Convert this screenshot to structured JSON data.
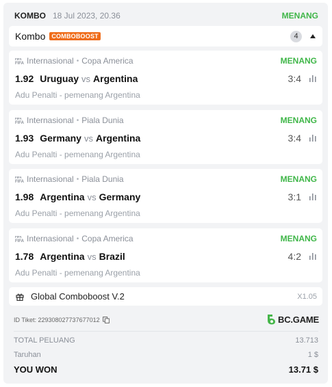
{
  "header": {
    "title": "KOMBO",
    "date": "18 Jul 2023, 20.36",
    "status": "MENANG"
  },
  "kombo": {
    "label": "Kombo",
    "badge": "COMBOBOOST",
    "count": "4"
  },
  "matches": [
    {
      "category": "Internasional",
      "league": "Copa America",
      "status": "MENANG",
      "odds": "1.92",
      "team1": "Uruguay",
      "vs": "vs",
      "team2": "Argentina",
      "score": "3:4",
      "market": "Adu Penalti - pemenang Argentina"
    },
    {
      "category": "Internasional",
      "league": "Piala Dunia",
      "status": "MENANG",
      "odds": "1.93",
      "team1": "Germany",
      "vs": "vs",
      "team2": "Argentina",
      "score": "3:4",
      "market": "Adu Penalti - pemenang Argentina"
    },
    {
      "category": "Internasional",
      "league": "Piala Dunia",
      "status": "MENANG",
      "odds": "1.98",
      "team1": "Argentina",
      "vs": "vs",
      "team2": "Germany",
      "score": "3:1",
      "market": "Adu Penalti - pemenang Argentina"
    },
    {
      "category": "Internasional",
      "league": "Copa America",
      "status": "MENANG",
      "odds": "1.78",
      "team1": "Argentina",
      "vs": "vs",
      "team2": "Brazil",
      "score": "4:2",
      "market": "Adu Penalti - pemenang Argentina"
    }
  ],
  "boost": {
    "label": "Global Comboboost V.2",
    "multiplier": "X1.05"
  },
  "ticket": {
    "id_text": "ID Tiket: 229308027737677012"
  },
  "brand": {
    "name": "BC.GAME",
    "color": "#46b64a"
  },
  "summary": {
    "total_label": "TOTAL PELUANG",
    "total_value": "13.713",
    "stake_label": "Taruhan",
    "stake_value": "1 $",
    "won_label": "YOU WON",
    "won_value": "13.71 $"
  },
  "colors": {
    "win_green": "#3fb648",
    "boost_orange": "#ef6c1a",
    "card_bg": "#f2f3f5"
  },
  "icons": [
    "fifa-icon",
    "stats-icon",
    "gift-icon",
    "copy-icon",
    "collapse-caret-icon",
    "bcgame-logo-icon"
  ]
}
